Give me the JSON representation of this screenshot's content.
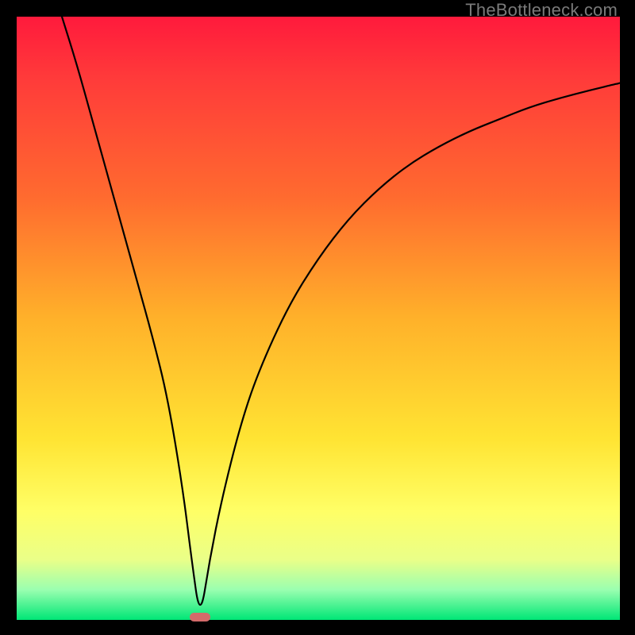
{
  "watermark": "TheBottleneck.com",
  "chart_data": {
    "type": "line",
    "title": "",
    "xlabel": "",
    "ylabel": "",
    "xlim": [
      0,
      100
    ],
    "ylim": [
      0,
      100
    ],
    "grid": false,
    "legend": false,
    "annotations": [],
    "marker": {
      "x": 30.4,
      "y": 0
    },
    "series": [
      {
        "name": "curve",
        "x": [
          7.5,
          10,
          12.5,
          15,
          17.5,
          20,
          22.5,
          25,
          27.5,
          29,
          30.4,
          32,
          34,
          37,
          40,
          45,
          50,
          55,
          60,
          65,
          70,
          75,
          80,
          85,
          90,
          95,
          100
        ],
        "y": [
          100,
          92,
          83,
          74,
          65,
          56,
          47,
          37,
          22,
          10,
          0,
          10,
          20,
          32,
          41,
          52,
          60,
          66.5,
          71.5,
          75.5,
          78.5,
          81,
          83,
          85,
          86.5,
          87.8,
          89
        ]
      }
    ]
  }
}
